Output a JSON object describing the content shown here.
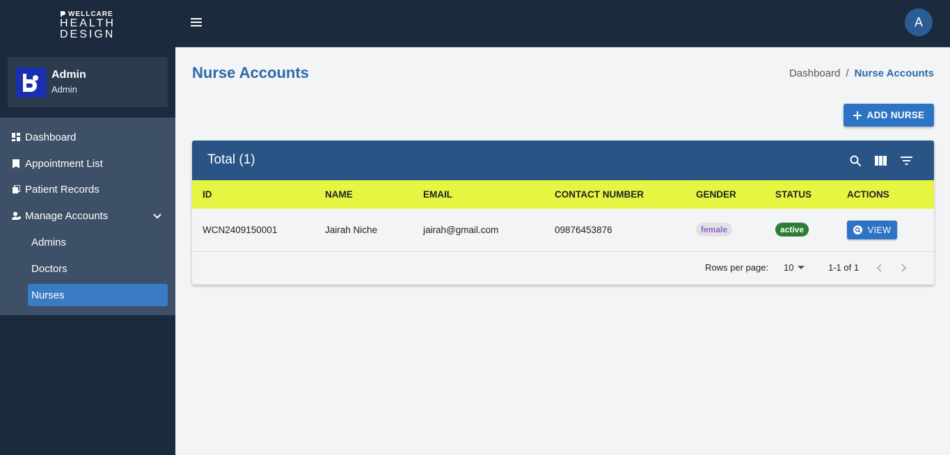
{
  "brand": {
    "line1": "WELLCARE",
    "line2": "HEALTH",
    "line3": "DESIGN"
  },
  "profile": {
    "name": "Admin",
    "role": "Admin"
  },
  "nav": {
    "dashboard": "Dashboard",
    "appointments": "Appointment List",
    "patients": "Patient Records",
    "manage": "Manage Accounts",
    "sub": {
      "admins": "Admins",
      "doctors": "Doctors",
      "nurses": "Nurses"
    }
  },
  "topbar": {
    "avatar_letter": "A"
  },
  "page": {
    "title": "Nurse Accounts"
  },
  "breadcrumb": {
    "home": "Dashboard",
    "sep": "/",
    "current": "Nurse Accounts"
  },
  "actions": {
    "add": "ADD NURSE"
  },
  "table": {
    "title": "Total (1)",
    "headers": {
      "id": "ID",
      "name": "NAME",
      "email": "EMAIL",
      "contact": "CONTACT NUMBER",
      "gender": "GENDER",
      "status": "STATUS",
      "actions": "ACTIONS"
    },
    "rows": [
      {
        "id": "WCN2409150001",
        "name": "Jairah Niche",
        "email": "jairah@gmail.com",
        "contact": "09876453876",
        "gender": "female",
        "status": "active",
        "action": "VIEW"
      }
    ],
    "footer": {
      "rows_per_page_label": "Rows per page:",
      "rows_per_page": "10",
      "range": "1-1 of 1"
    }
  },
  "colors": {
    "sidebar": "#1b2a3d",
    "nav_bg": "#3e5068",
    "primary": "#2d74c4",
    "table_head": "#e6f542",
    "card_head": "#2a5386",
    "active_chip": "#2e7d32"
  }
}
